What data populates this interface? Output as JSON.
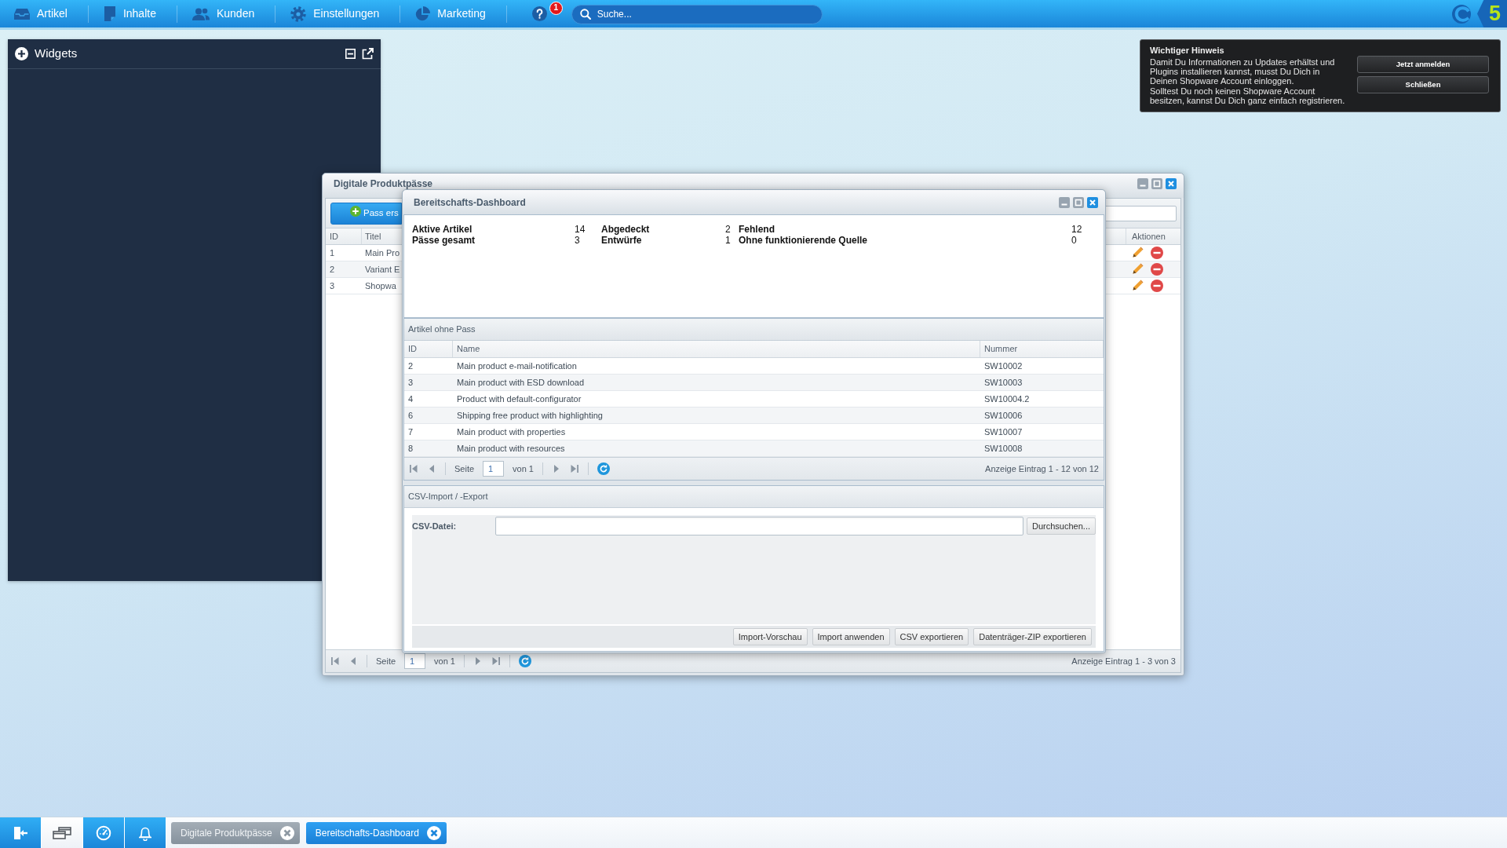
{
  "top_bar": {
    "menu": [
      {
        "label": "Artikel"
      },
      {
        "label": "Inhalte"
      },
      {
        "label": "Kunden"
      },
      {
        "label": "Einstellungen"
      },
      {
        "label": "Marketing"
      }
    ],
    "help_badge": "1",
    "search": {
      "placeholder": "Suche..."
    },
    "logo_tile": "5"
  },
  "widgets": {
    "title": "Widgets"
  },
  "notice": {
    "title": "Wichtiger Hinweis",
    "paragraphs": [
      "Damit Du Informationen zu Updates erhältst und Plugins installieren kannst, musst Du Dich in Deinen Shopware Account einloggen.",
      "Solltest Du noch keinen Shopware Account besitzen, kannst Du Dich ganz einfach registrieren."
    ],
    "buttons": [
      "Jetzt anmelden",
      "Schließen"
    ]
  },
  "back_window": {
    "title": "Digitale Produktpässe",
    "create_button": "Pass ers",
    "columns": [
      "ID",
      "Titel",
      "Aktionen"
    ],
    "rows": [
      {
        "id": "1",
        "title": "Main Pro"
      },
      {
        "id": "2",
        "title": "Variant E"
      },
      {
        "id": "3",
        "title": "Shopwa"
      }
    ],
    "paging": {
      "page_label": "Seite",
      "page": "1",
      "of": "von 1",
      "info": "Anzeige Eintrag 1 - 3 von 3"
    }
  },
  "front_window": {
    "title": "Bereitschafts-Dashboard",
    "stats": [
      {
        "label": "Aktive Artikel",
        "value": "14"
      },
      {
        "label": "Abgedeckt",
        "value": "2"
      },
      {
        "label": "Fehlend",
        "value": "12"
      },
      {
        "label": "Pässe gesamt",
        "value": "3"
      },
      {
        "label": "Entwürfe",
        "value": "1"
      },
      {
        "label": "Ohne funktionierende Quelle",
        "value": "0"
      }
    ],
    "articles_panel": {
      "title": "Artikel ohne Pass",
      "columns": [
        "ID",
        "Name",
        "Nummer"
      ],
      "rows": [
        {
          "id": "2",
          "name": "Main product e-mail-notification",
          "number": "SW10002"
        },
        {
          "id": "3",
          "name": "Main product with ESD download",
          "number": "SW10003"
        },
        {
          "id": "4",
          "name": "Product with default-configurator",
          "number": "SW10004.2"
        },
        {
          "id": "6",
          "name": "Shipping free product with highlighting",
          "number": "SW10006"
        },
        {
          "id": "7",
          "name": "Main product with properties",
          "number": "SW10007"
        },
        {
          "id": "8",
          "name": "Main product with resources",
          "number": "SW10008"
        }
      ],
      "paging": {
        "page_label": "Seite",
        "page": "1",
        "of": "von 1",
        "info": "Anzeige Eintrag 1 - 12 von 12"
      }
    },
    "csv_panel": {
      "title": "CSV-Import / -Export",
      "file_label": "CSV-Datei:",
      "browse_button": "Durchsuchen...",
      "buttons": [
        "Import-Vorschau",
        "Import anwenden",
        "CSV exportieren",
        "Datenträger-ZIP exportieren"
      ]
    }
  },
  "taskbar": {
    "quick_buttons": [
      {
        "selected": false
      },
      {
        "selected": true
      },
      {
        "selected": false
      },
      {
        "selected": false
      }
    ],
    "tasks": [
      {
        "label": "Digitale Produktpässe",
        "selected": false
      },
      {
        "label": "Bereitschafts-Dashboard",
        "selected": true
      }
    ]
  }
}
